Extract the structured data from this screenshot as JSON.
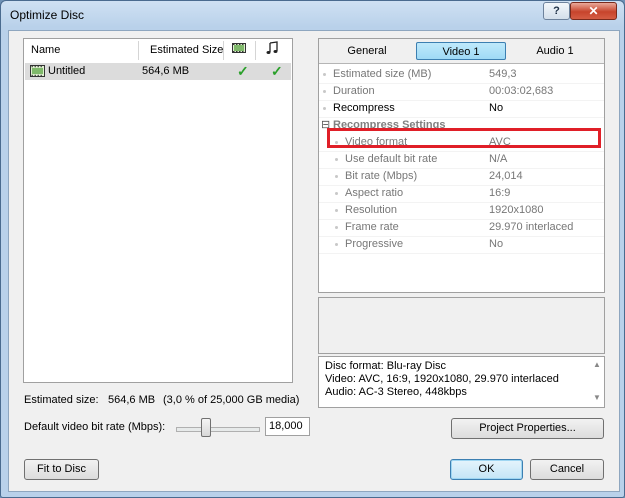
{
  "window": {
    "title": "Optimize Disc",
    "help_label": "?",
    "close_label": "✕"
  },
  "list": {
    "columns": {
      "name": "Name",
      "size": "Estimated Size",
      "video_icon": "film-icon",
      "audio_icon": "music-note-icon"
    },
    "rows": [
      {
        "name": "Untitled",
        "size": "564,6 MB",
        "video_ok": "✓",
        "audio_ok": "✓"
      }
    ]
  },
  "tabs": [
    "General",
    "Video 1",
    "Audio 1"
  ],
  "active_tab": "Video 1",
  "properties": [
    {
      "name": "Estimated size (MB)",
      "value": "549,3"
    },
    {
      "name": "Duration",
      "value": "00:03:02,683"
    },
    {
      "name": "Recompress",
      "value": "No"
    }
  ],
  "category": {
    "title": "Recompress Settings",
    "toggle": "⊟"
  },
  "sub_properties": [
    {
      "name": "Video format",
      "value": "AVC"
    },
    {
      "name": "Use default bit rate",
      "value": "N/A"
    },
    {
      "name": "Bit rate (Mbps)",
      "value": "24,014"
    },
    {
      "name": "Aspect ratio",
      "value": "16:9"
    },
    {
      "name": "Resolution",
      "value": "1920x1080"
    },
    {
      "name": "Frame rate",
      "value": "29.970 interlaced"
    },
    {
      "name": "Progressive",
      "value": "No"
    }
  ],
  "info": {
    "line1": "Disc format:  Blu-ray Disc",
    "line2": "Video:  AVC, 16:9, 1920x1080, 29.970 interlaced",
    "line3": "Audio:  AC-3 Stereo, 448kbps"
  },
  "estimated": {
    "label": "Estimated size:",
    "value": "564,6 MB",
    "detail": "(3,0 % of 25,000 GB media)"
  },
  "bitrate": {
    "label": "Default video bit rate (Mbps):",
    "value": "18,000",
    "slider_fraction": 0.35
  },
  "buttons": {
    "project_properties": "Project Properties...",
    "fit_to_disc": "Fit to Disc",
    "ok": "OK",
    "cancel": "Cancel"
  },
  "colors": {
    "highlight": "#e01f28",
    "active_tab": "#9fdaf6",
    "check": "#2aa02a"
  }
}
